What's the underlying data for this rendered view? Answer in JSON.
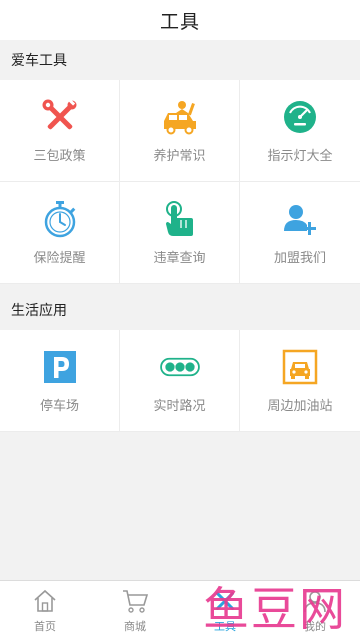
{
  "header": {
    "title": "工具"
  },
  "sections": [
    {
      "title": "爱车工具",
      "items": [
        {
          "label": "三包政策",
          "icon": "wrench-screwdriver-icon"
        },
        {
          "label": "养护常识",
          "icon": "car-repair-icon"
        },
        {
          "label": "指示灯大全",
          "icon": "gauge-icon"
        },
        {
          "label": "保险提醒",
          "icon": "stopwatch-icon"
        },
        {
          "label": "违章查询",
          "icon": "hand-tap-icon"
        },
        {
          "label": "加盟我们",
          "icon": "add-user-icon"
        }
      ]
    },
    {
      "title": "生活应用",
      "items": [
        {
          "label": "停车场",
          "icon": "parking-icon"
        },
        {
          "label": "实时路况",
          "icon": "traffic-light-icon"
        },
        {
          "label": "周边加油站",
          "icon": "gas-station-car-icon"
        }
      ]
    }
  ],
  "tabbar": {
    "tabs": [
      {
        "label": "首页",
        "icon": "home-icon",
        "active": false
      },
      {
        "label": "商城",
        "icon": "cart-icon",
        "active": false
      },
      {
        "label": "工具",
        "icon": "tools-icon",
        "active": true
      },
      {
        "label": "我的",
        "icon": "user-icon",
        "active": false
      }
    ]
  },
  "watermark": {
    "text": "鱼豆网"
  },
  "colors": {
    "red": "#f0544f",
    "orange": "#f5a623",
    "teal": "#1fb28a",
    "blue": "#3ea3e0",
    "active_tab": "#2aa3dd",
    "watermark": "#e83b91"
  }
}
